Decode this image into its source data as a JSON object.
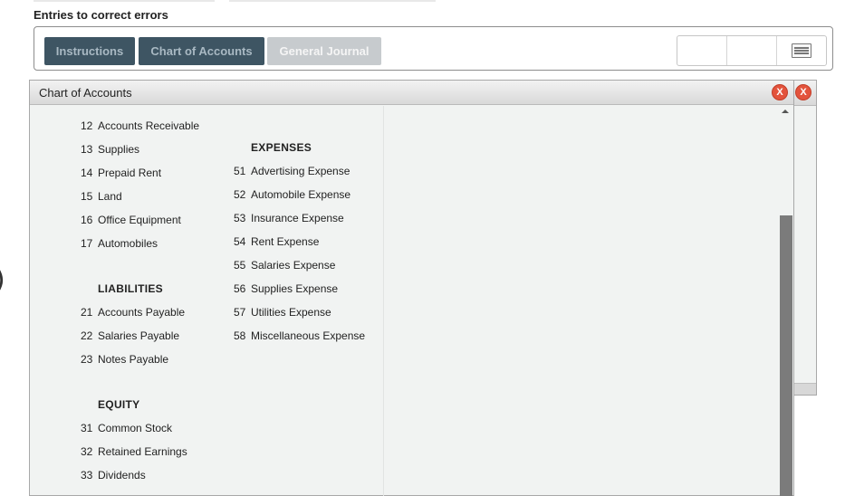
{
  "page": {
    "heading": "Entries to correct errors"
  },
  "tabs": [
    {
      "label": "Instructions",
      "state": "inactive"
    },
    {
      "label": "Chart of Accounts",
      "state": "inactive"
    },
    {
      "label": "General Journal",
      "state": "active"
    }
  ],
  "toolbar": {
    "icons": [
      "blank",
      "blank",
      "menu-lines-icon"
    ]
  },
  "side_mark": ")",
  "chart_panel": {
    "title": "Chart of Accounts",
    "close_label": "X",
    "left_column": [
      {
        "number": "12",
        "name": "Accounts Receivable"
      },
      {
        "number": "13",
        "name": "Supplies"
      },
      {
        "number": "14",
        "name": "Prepaid Rent"
      },
      {
        "number": "15",
        "name": "Land"
      },
      {
        "number": "16",
        "name": "Office Equipment"
      },
      {
        "number": "17",
        "name": "Automobiles"
      },
      {
        "section": "LIABILITIES"
      },
      {
        "number": "21",
        "name": "Accounts Payable"
      },
      {
        "number": "22",
        "name": "Salaries Payable"
      },
      {
        "number": "23",
        "name": "Notes Payable"
      },
      {
        "section": "EQUITY"
      },
      {
        "number": "31",
        "name": "Common Stock"
      },
      {
        "number": "32",
        "name": "Retained Earnings"
      },
      {
        "number": "33",
        "name": "Dividends"
      }
    ],
    "right_column": [
      {
        "section": "EXPENSES"
      },
      {
        "number": "51",
        "name": "Advertising Expense"
      },
      {
        "number": "52",
        "name": "Automobile Expense"
      },
      {
        "number": "53",
        "name": "Insurance Expense"
      },
      {
        "number": "54",
        "name": "Rent Expense"
      },
      {
        "number": "55",
        "name": "Salaries Expense"
      },
      {
        "number": "56",
        "name": "Supplies Expense"
      },
      {
        "number": "57",
        "name": "Utilities Expense"
      },
      {
        "number": "58",
        "name": "Miscellaneous Expense"
      }
    ]
  },
  "background_panel": {
    "close_label": "X"
  },
  "colors": {
    "tab_dark": "#3e5563",
    "tab_light": "#c7cbce",
    "close": "#e3533c",
    "panel_bg": "#f1f3f2"
  }
}
